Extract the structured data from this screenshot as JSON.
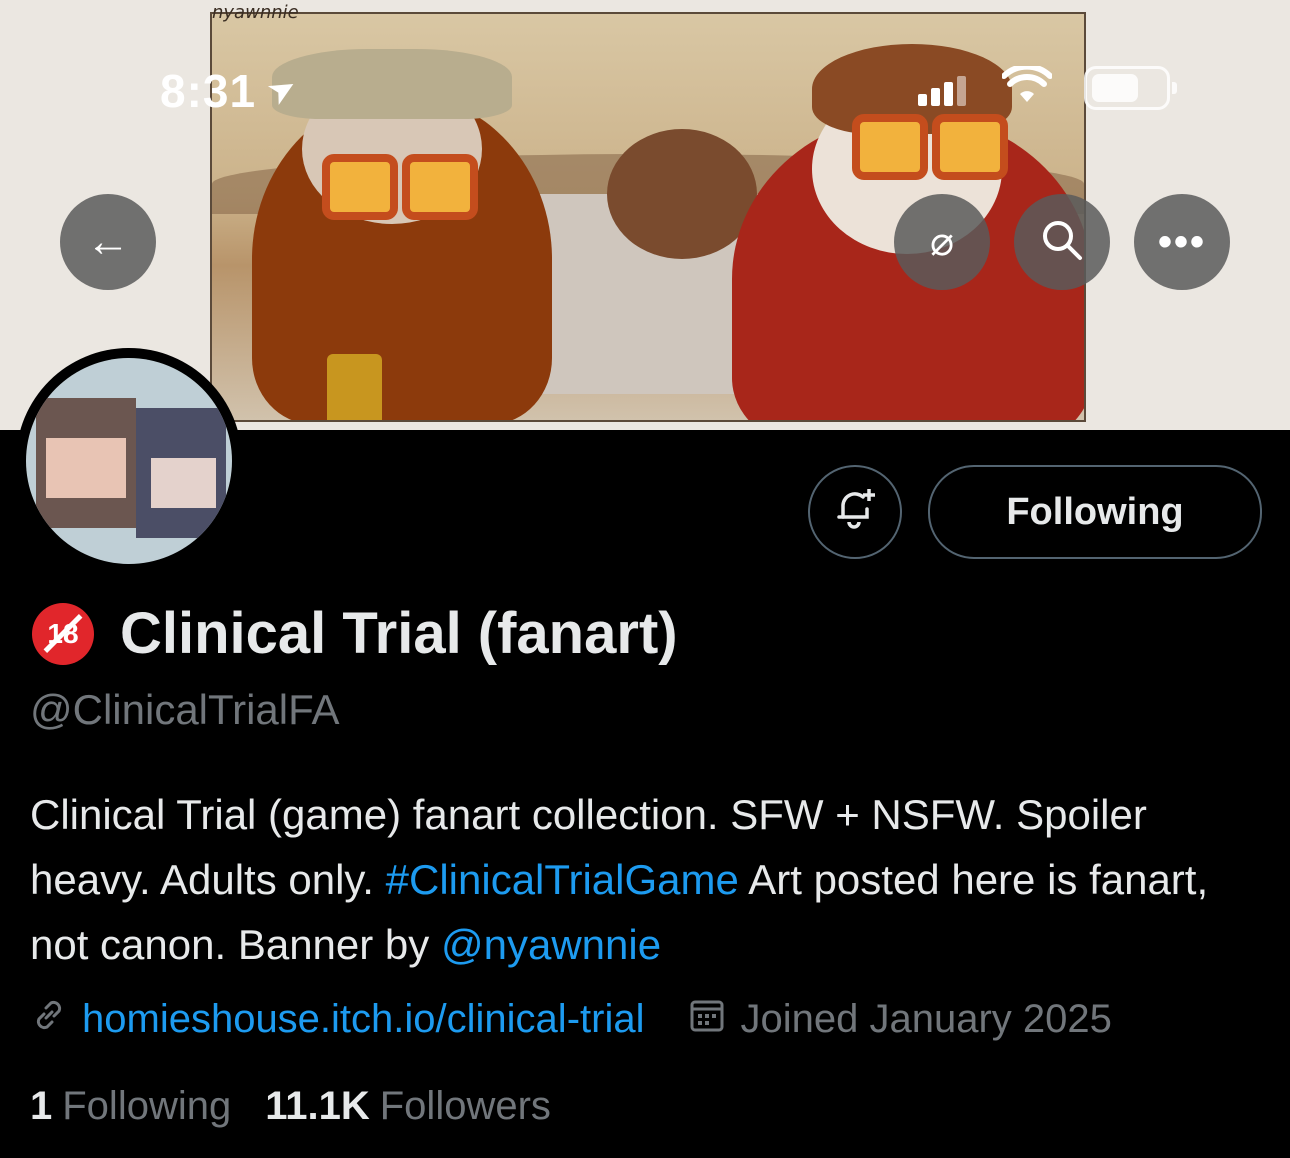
{
  "status_bar": {
    "time": "8:31"
  },
  "banner": {
    "signature": "nyawnnie"
  },
  "nav": {
    "back": "←",
    "grok": "⌀",
    "more": "•••"
  },
  "actions": {
    "bell": "🔔",
    "following_label": "Following"
  },
  "profile": {
    "badge": "18",
    "display_name": "Clinical Trial (fanart)",
    "handle": "@ClinicalTrialFA",
    "bio": {
      "part1": "Clinical Trial (game) fanart collection. SFW + NSFW. Spoiler heavy. Adults only. ",
      "hashtag": "#ClinicalTrialGame",
      "part2": " Art posted here is fanart, not canon. Banner by ",
      "mention": "@nyawnnie"
    },
    "website": "homieshouse.itch.io/clinical-trial",
    "joined": "Joined January 2025",
    "following_count": "1",
    "following_label": "Following",
    "followers_count": "11.1K",
    "followers_label": "Followers"
  },
  "icons": {
    "back": "arrow-left-icon",
    "grok": "grok-icon",
    "search": "search-icon",
    "more": "more-icon",
    "bell": "bell-plus-icon",
    "link": "link-icon",
    "calendar": "calendar-icon"
  },
  "colors": {
    "accent": "#1d9bf0",
    "muted": "#71767b",
    "background": "#000000",
    "text": "#e7e9ea",
    "badge": "#e1262b"
  }
}
